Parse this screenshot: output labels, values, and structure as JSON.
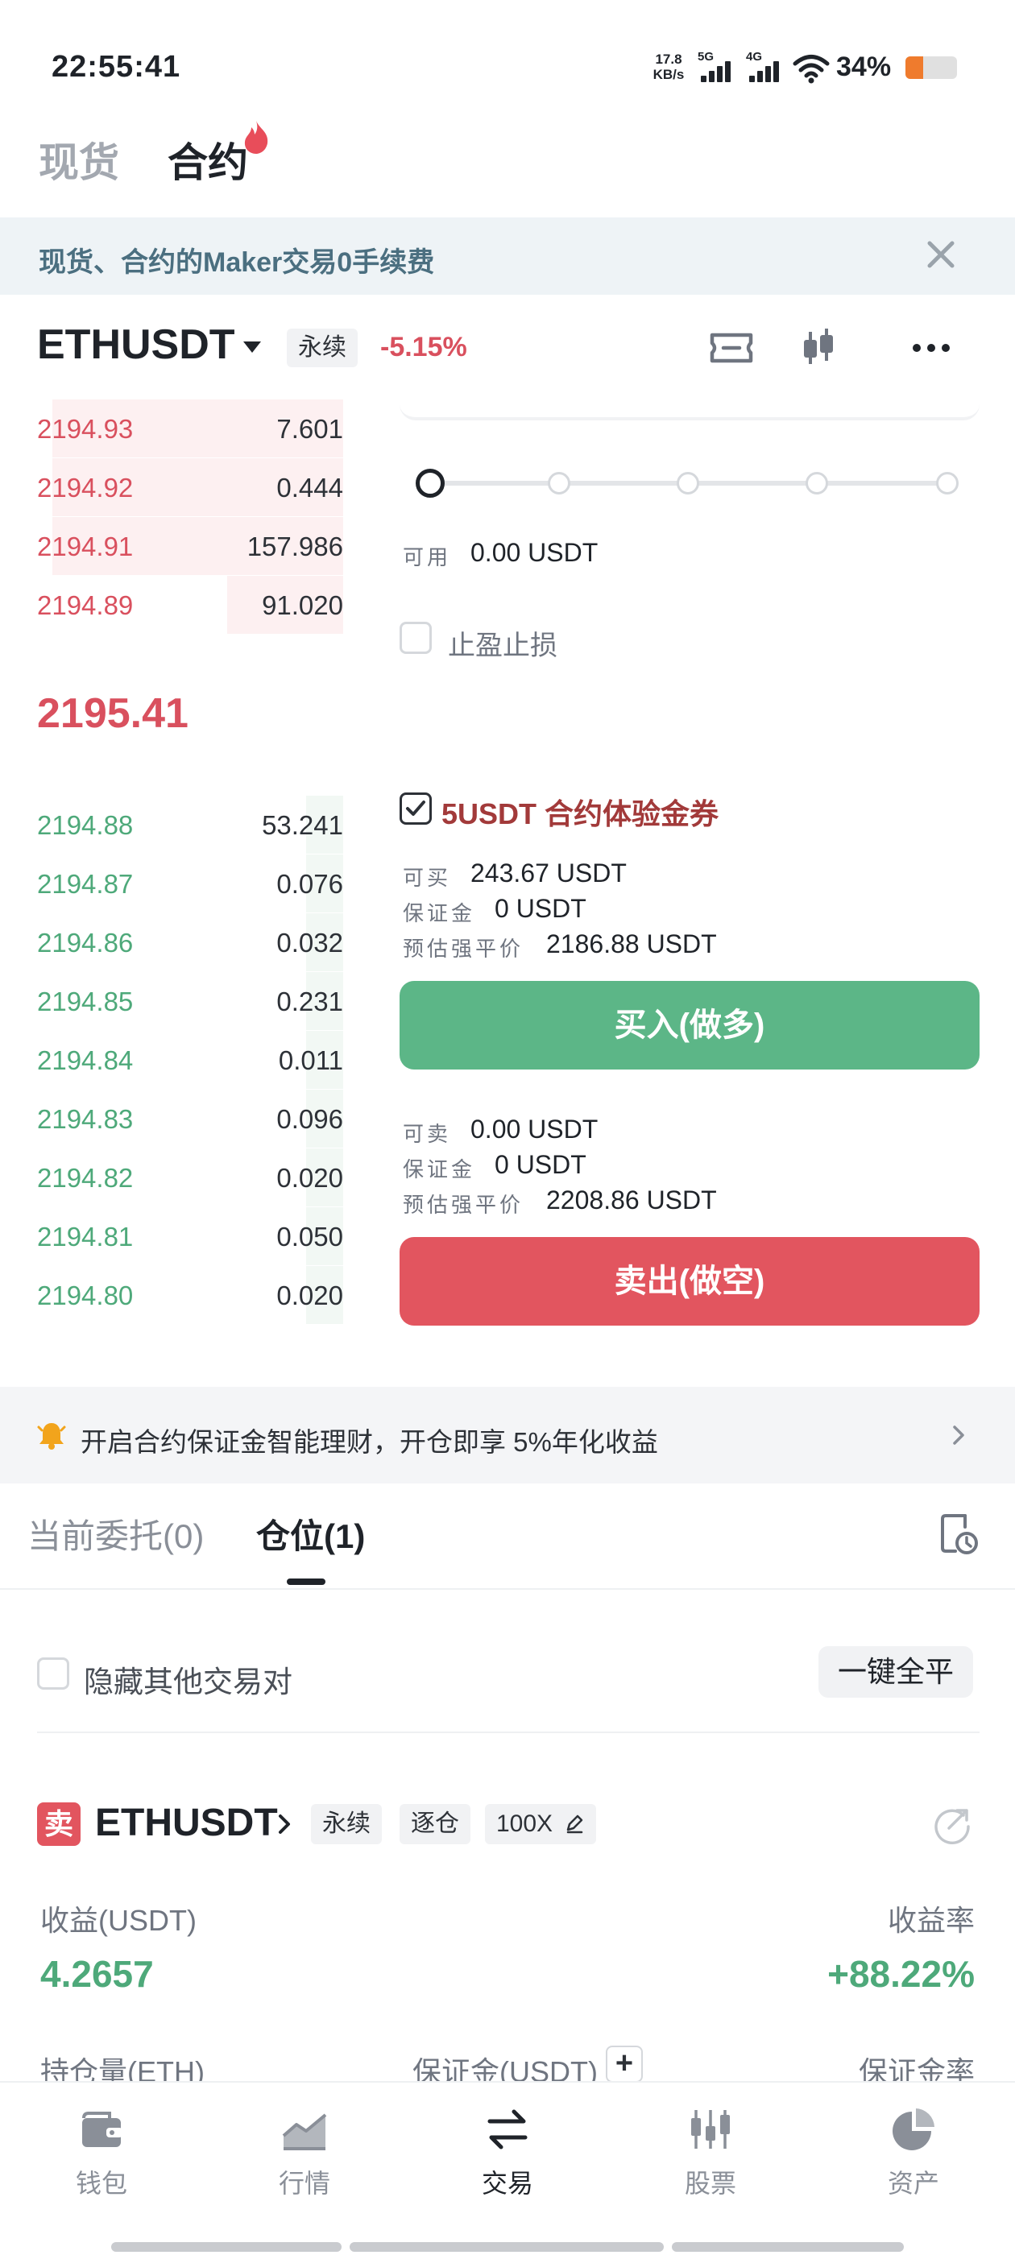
{
  "status_bar": {
    "time": "22:55:41",
    "net_speed_value": "17.8",
    "net_speed_unit": "KB/s",
    "network_5g": "5G",
    "network_4g": "4G",
    "battery_text": "34%",
    "battery_level": 0.34,
    "battery_color": "#ef7b2d"
  },
  "top_tabs": {
    "spot": "现货",
    "futures": "合约"
  },
  "promo": {
    "text": "现货、合约的Maker交易0手续费"
  },
  "header": {
    "symbol": "ETHUSDT",
    "contract_type": "永续",
    "change": "-5.15%"
  },
  "order_book": {
    "asks": [
      {
        "price": "2194.93",
        "qty": "7.601",
        "depth": 0.95
      },
      {
        "price": "2194.92",
        "qty": "0.444",
        "depth": 0.95
      },
      {
        "price": "2194.91",
        "qty": "157.986",
        "depth": 0.95
      },
      {
        "price": "2194.89",
        "qty": "91.020",
        "depth": 0.38
      }
    ],
    "last_price": "2195.41",
    "bids": [
      {
        "price": "2194.88",
        "qty": "53.241",
        "depth": 0.12
      },
      {
        "price": "2194.87",
        "qty": "0.076",
        "depth": 0.12
      },
      {
        "price": "2194.86",
        "qty": "0.032",
        "depth": 0.12
      },
      {
        "price": "2194.85",
        "qty": "0.231",
        "depth": 0.12
      },
      {
        "price": "2194.84",
        "qty": "0.011",
        "depth": 0.12
      },
      {
        "price": "2194.83",
        "qty": "0.096",
        "depth": 0.12
      },
      {
        "price": "2194.82",
        "qty": "0.020",
        "depth": 0.12
      },
      {
        "price": "2194.81",
        "qty": "0.050",
        "depth": 0.12
      },
      {
        "price": "2194.80",
        "qty": "0.020",
        "depth": 0.12
      }
    ]
  },
  "order_form": {
    "available_label": "可用",
    "available_value": "0.00 USDT",
    "tp_sl_label": "止盈止损",
    "voucher_label": "5USDT 合约体验金券",
    "voucher_checked": true,
    "buy": {
      "max_label": "可买",
      "max_value": "243.67 USDT",
      "margin_label": "保证金",
      "margin_value": "0 USDT",
      "liq_label": "预估强平价",
      "liq_value": "2186.88 USDT",
      "button": "买入(做多)"
    },
    "sell": {
      "max_label": "可卖",
      "max_value": "0.00 USDT",
      "margin_label": "保证金",
      "margin_value": "0 USDT",
      "liq_label": "预估强平价",
      "liq_value": "2208.86 USDT",
      "button": "卖出(做空)"
    }
  },
  "notice": {
    "text": "开启合约保证金智能理财，开仓即享 5%年化收益"
  },
  "orders_tabs": {
    "open_orders": "当前委托(0)",
    "positions": "仓位(1)"
  },
  "positions": {
    "hide_others_label": "隐藏其他交易对",
    "close_all": "一键全平",
    "item": {
      "side": "卖",
      "symbol": "ETHUSDT",
      "tag_type": "永续",
      "tag_margin_mode": "逐仓",
      "leverage": "100X",
      "pnl_label": "收益(USDT)",
      "pnl_value": "4.2657",
      "roe_label": "收益率",
      "roe_value": "+88.22%",
      "size_label": "持仓量(ETH)",
      "margin_label": "保证金(USDT)",
      "margin_ratio_label": "保证金率"
    }
  },
  "bottom_nav": [
    {
      "label": "钱包",
      "icon": "wallet-icon"
    },
    {
      "label": "行情",
      "icon": "chart-icon"
    },
    {
      "label": "交易",
      "icon": "swap-icon",
      "active": true
    },
    {
      "label": "股票",
      "icon": "stocks-icon"
    },
    {
      "label": "资产",
      "icon": "pie-icon"
    }
  ],
  "colors": {
    "ask": "#d9505e",
    "bid": "#4ea97a",
    "buy": "#5cb687",
    "sell": "#e2555f"
  }
}
